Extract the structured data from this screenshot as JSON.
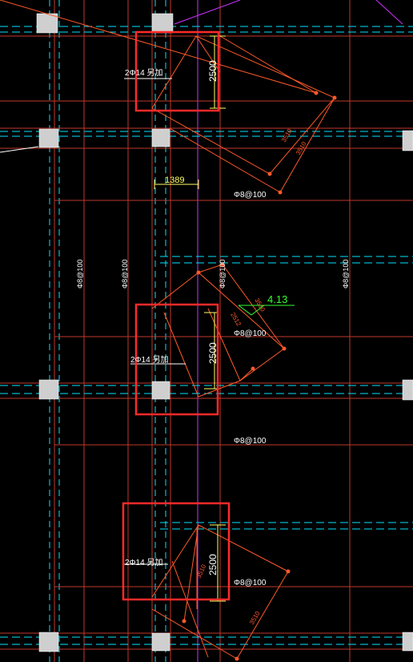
{
  "colors": {
    "background": "#000000",
    "grid_red": "#c0392b",
    "grid_cyan": "#00e5ff",
    "axis_magenta": "#cc33ff",
    "highlight_box": "#ff2a2a",
    "column_fill": "#cfcfcf",
    "text_white": "#ffffff",
    "dimension_yellow": "#ffff66",
    "level_green": "#33ff33",
    "leader_orange": "#ff5a2a"
  },
  "labels": {
    "rebar_top": "2Φ14 另加",
    "rebar_mid": "2Φ14 另加",
    "rebar_bot": "2Φ14 另加",
    "dim_top": "2500",
    "dim_mid": "2500",
    "dim_bot": "2500",
    "dim_1389": "1389",
    "stirrup_1": "Φ8@100",
    "stirrup_2": "Φ8@100",
    "stirrup_3": "Φ8@100",
    "stirrup_4": "Φ8@100",
    "vert_1": "Φ8@100",
    "vert_2": "Φ8@100",
    "vert_3": "Φ8@100",
    "vert_4": "Φ8@100",
    "level": "4.13",
    "diag_1": "3510",
    "diag_2": "3510",
    "diag_3": "2512",
    "diag_4": "3510",
    "diag_5": "3510",
    "diag_6": "3510"
  }
}
